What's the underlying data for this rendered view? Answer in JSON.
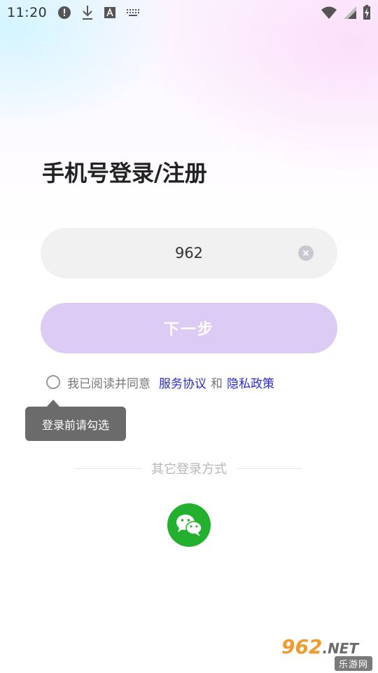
{
  "status_bar": {
    "time": "11:20",
    "icons": [
      "alert-icon",
      "download-icon",
      "text-a-icon",
      "keyboard-icon",
      "wifi-icon",
      "signal-icon",
      "battery-charging-icon"
    ]
  },
  "login": {
    "title": "手机号登录/注册",
    "phone_value": "962",
    "clear_icon": "clear-icon",
    "next_label": "下一步",
    "agreement_prefix": "我已阅读并同意",
    "service_link": "服务协议",
    "and_text": "和",
    "privacy_link": "隐私政策",
    "tooltip": "登录前请勾选",
    "other_methods_label": "其它登录方式",
    "wechat_icon": "wechat-icon"
  },
  "watermark": {
    "brand": "962",
    "dot": ".",
    "tld": "NET",
    "sub": "乐游网"
  },
  "colors": {
    "next_button": "#dccbf4",
    "link": "#2a2ad0",
    "wechat": "#22b02e",
    "tooltip": "#6b6b6b"
  }
}
